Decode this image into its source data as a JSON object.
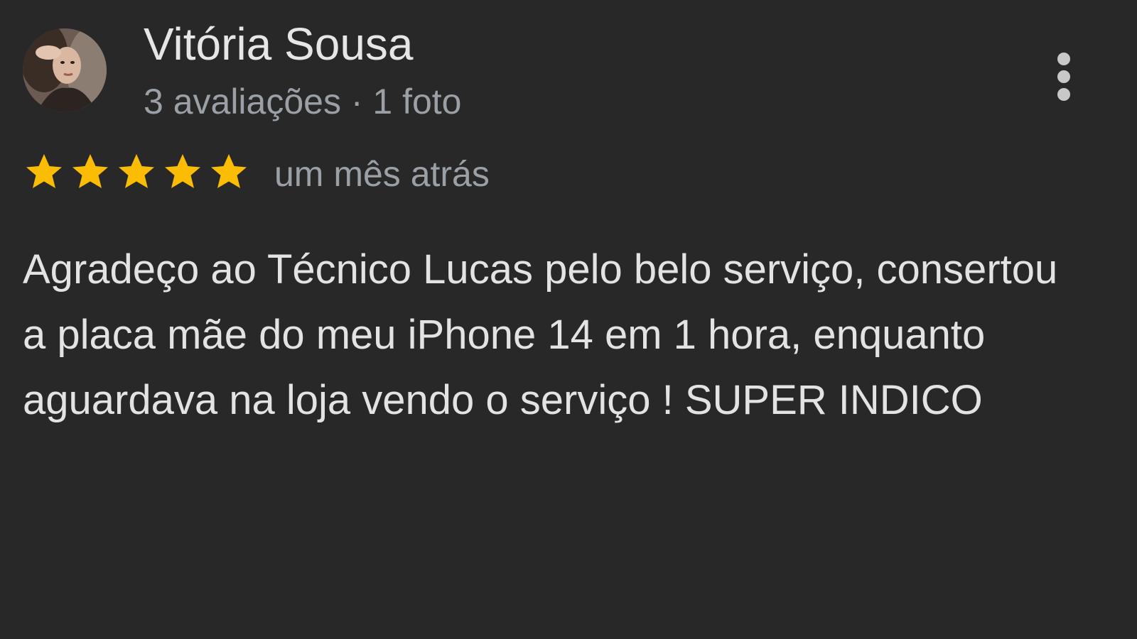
{
  "reviewer": {
    "name": "Vitória Sousa",
    "meta": "3 avaliações · 1 foto",
    "avatar_icon": "profile-photo"
  },
  "rating": {
    "stars": 5,
    "max": 5,
    "star_color": "#fbbc04"
  },
  "review": {
    "date": "um mês atrás",
    "text": "Agradeço ao Técnico Lucas pelo belo serviço, consertou a placa mãe do meu iPhone 14 em 1 hora, enquanto aguardava na loja vendo o serviço ! SUPER INDICO"
  },
  "menu": {
    "icon": "more-vert-icon"
  },
  "colors": {
    "background": "#282828",
    "primary_text": "#e3e3e3",
    "secondary_text": "#9aa0a6"
  }
}
